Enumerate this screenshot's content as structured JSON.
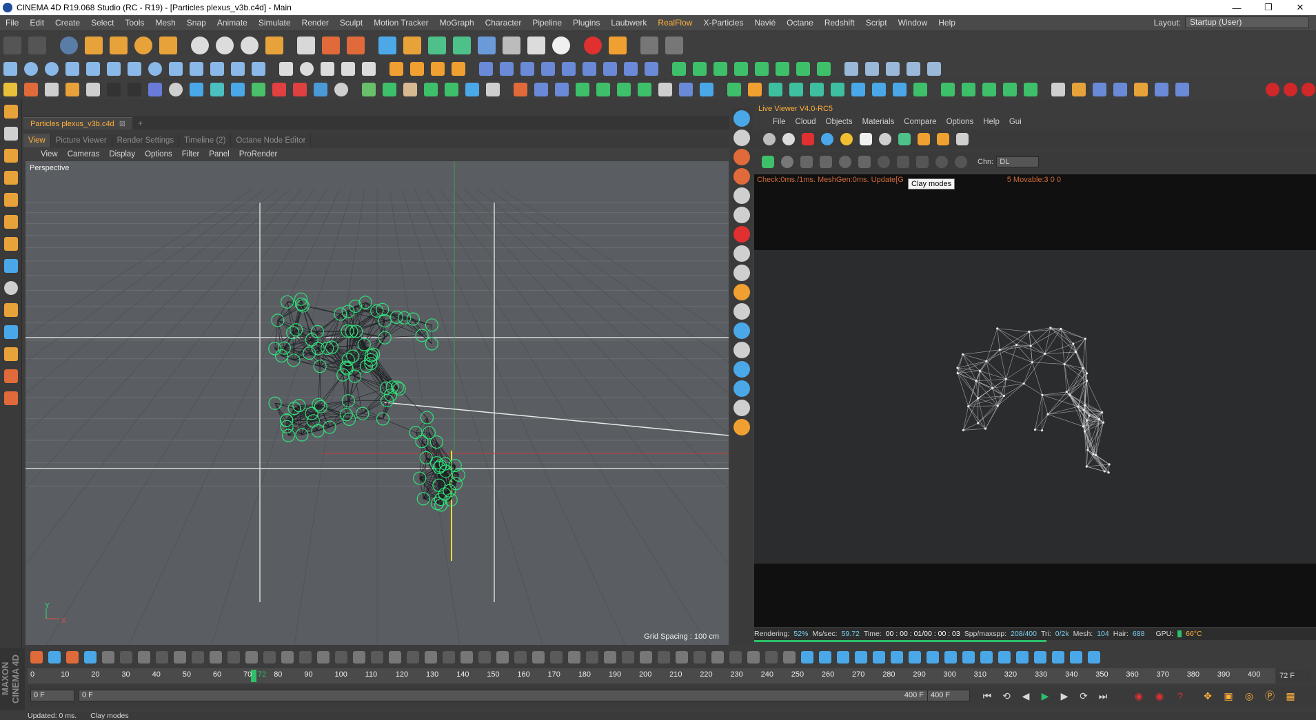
{
  "titlebar": {
    "title": "CINEMA 4D R19.068 Studio (RC - R19) - [Particles plexus_v3b.c4d] - Main",
    "minimize": "—",
    "maximize": "❐",
    "close": "✕"
  },
  "menubar": {
    "items": [
      "File",
      "Edit",
      "Create",
      "Select",
      "Tools",
      "Mesh",
      "Snap",
      "Animate",
      "Simulate",
      "Render",
      "Sculpt",
      "Motion Tracker",
      "MoGraph",
      "Character",
      "Pipeline",
      "Plugins",
      "Laubwerk",
      "RealFlow",
      "X-Particles",
      "Navié",
      "Octane",
      "Redshift",
      "Script",
      "Window",
      "Help"
    ],
    "highlighted": "RealFlow",
    "layout_label": "Layout:",
    "layout_value": "Startup (User)"
  },
  "document_tab": {
    "label": "Particles plexus_v3b.c4d",
    "close": "⊠",
    "add": "+"
  },
  "view_tabs": [
    {
      "label": "View",
      "active": true
    },
    {
      "label": "Picture Viewer",
      "active": false
    },
    {
      "label": "Render Settings",
      "active": false
    },
    {
      "label": "Timeline (2)",
      "active": false
    },
    {
      "label": "Octane Node Editor",
      "active": false
    }
  ],
  "view_menu": [
    "View",
    "Cameras",
    "Display",
    "Options",
    "Filter",
    "Panel",
    "ProRender"
  ],
  "viewport": {
    "label": "Perspective",
    "grid_spacing": "Grid Spacing : 100 cm",
    "axis_x": "X",
    "axis_y": "Y"
  },
  "live_viewer": {
    "title": "Live Viewer V4.0-RC5",
    "menu": [
      "File",
      "Cloud",
      "Objects",
      "Materials",
      "Compare",
      "Options",
      "Help",
      "Gui"
    ],
    "chn_label": "Chn:",
    "chn_value": "DL",
    "check_line": "Check:0ms./1ms. MeshGen:0ms. Update[G",
    "check_line_tail": "5 Movable:3  0 0",
    "tooltip": "Clay modes",
    "status": {
      "rendering_label": "Rendering:",
      "rendering_value": "52%",
      "mssec_label": "Ms/sec:",
      "mssec_value": "59.72",
      "time_label": "Time:",
      "time_value": "00 : 00 : 01/00 : 00 : 03",
      "spp_label": "Spp/maxspp:",
      "spp_value": "208/400",
      "tri_label": "Tri:",
      "tri_value": "0/2k",
      "mesh_label": "Mesh:",
      "mesh_value": "104",
      "hair_label": "Hair:",
      "hair_value": "688",
      "gpu_label": "GPU:",
      "gpu_value": "66°C"
    },
    "progress": 0.52
  },
  "timeline": {
    "ticks": [
      "0",
      "10",
      "20",
      "30",
      "40",
      "50",
      "60",
      "70",
      "72",
      "80",
      "90",
      "100",
      "110",
      "120",
      "130",
      "140",
      "150",
      "160",
      "170",
      "180",
      "190",
      "200",
      "210",
      "220",
      "230",
      "240",
      "250",
      "260",
      "270",
      "280",
      "290",
      "300",
      "310",
      "320",
      "330",
      "340",
      "350",
      "360",
      "370",
      "380",
      "390",
      "400"
    ],
    "current_frame": "72",
    "end_label": "72 F"
  },
  "transport": {
    "start_field": "0 F",
    "min_field": "0 F",
    "max_field": "400 F",
    "end_field": "400 F"
  },
  "brand": "MAXON CINEMA 4D",
  "statusbar": {
    "left": "Updated: 0 ms.",
    "right": "Clay modes"
  },
  "colors": {
    "accent": "#ffb13b",
    "particle": "#2ee27a",
    "viewport_bg": "#5a5e62"
  }
}
